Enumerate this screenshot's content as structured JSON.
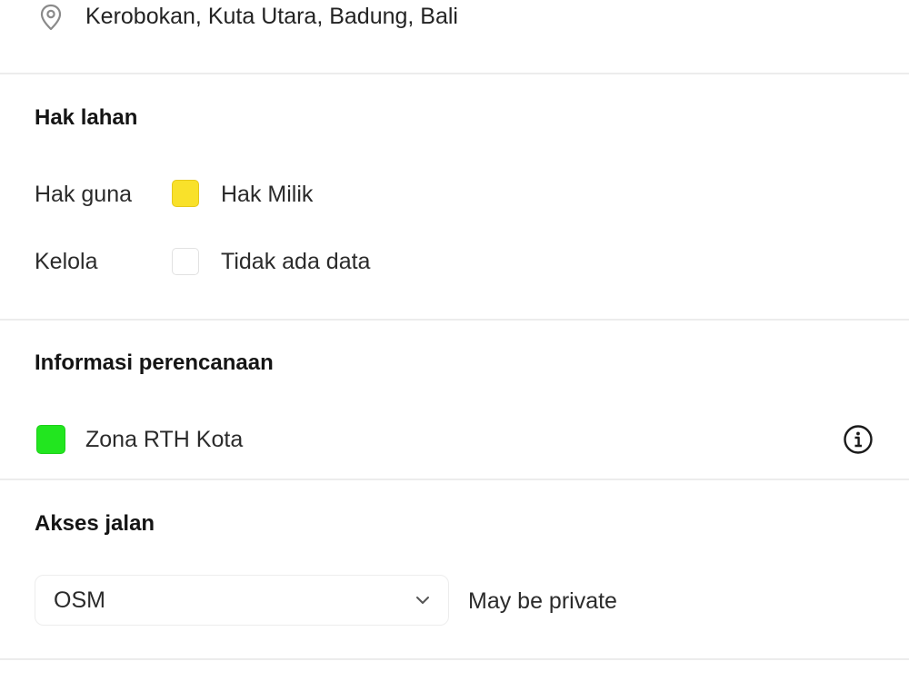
{
  "location": {
    "icon": "map-pin-icon",
    "address": "Kerobokan, Kuta Utara, Badung, Bali"
  },
  "land_rights": {
    "title": "Hak lahan",
    "rows": [
      {
        "label": "Hak guna",
        "value": "Hak Milik",
        "swatch_color": "#f9e12a"
      },
      {
        "label": "Kelola",
        "value": "Tidak ada data",
        "swatch_color": "#ffffff"
      }
    ]
  },
  "planning": {
    "title": "Informasi perencanaan",
    "zone": {
      "label": "Zona RTH Kota",
      "swatch_color": "#22e61f"
    },
    "info_icon": "info-circle-icon"
  },
  "road_access": {
    "title": "Akses jalan",
    "source_select": {
      "selected": "OSM",
      "icon": "chevron-down-icon"
    },
    "note": "May be private"
  }
}
